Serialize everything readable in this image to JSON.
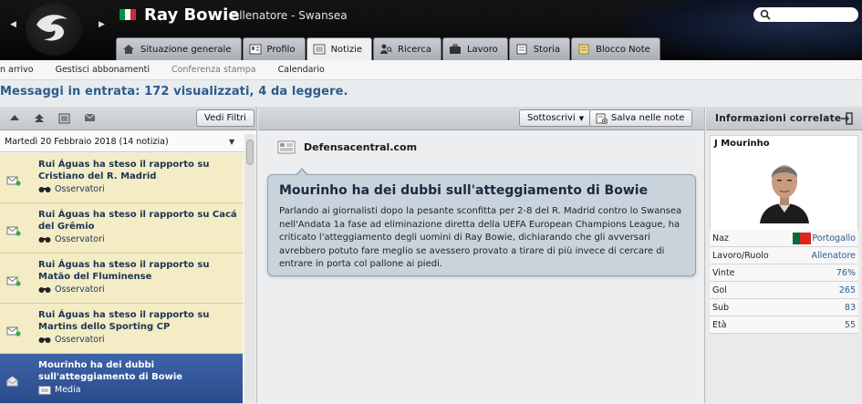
{
  "header": {
    "manager_name": "Ray Bowie",
    "manager_role": "Allenatore - Swansea",
    "flag_colors": [
      "#009246",
      "#ffffff",
      "#ce2b37"
    ]
  },
  "tabs": [
    {
      "label": "Situazione generale",
      "icon": "home-icon",
      "active": false
    },
    {
      "label": "Profilo",
      "icon": "profile-card-icon",
      "active": false
    },
    {
      "label": "Notizie",
      "icon": "news-icon",
      "active": true
    },
    {
      "label": "Ricerca",
      "icon": "scout-icon",
      "active": false
    },
    {
      "label": "Lavoro",
      "icon": "briefcase-icon",
      "active": false
    },
    {
      "label": "Storia",
      "icon": "book-icon",
      "active": false
    },
    {
      "label": "Blocco Note",
      "icon": "notepad-icon",
      "active": false
    }
  ],
  "subnav": {
    "items": [
      "n arrivo",
      "Gestisci abbonamenti",
      "Conferenza stampa",
      "Calendario"
    ]
  },
  "inbox": {
    "title": "Messaggi in entrata: 172 visualizzati, 4 da leggere."
  },
  "left_panel": {
    "filter_button": "Vedi Filtri",
    "date_header": "Martedì 20 Febbraio 2018 (14 notizia)",
    "messages": [
      {
        "title": "Rui Águas ha steso il rapporto su Cristiano del R. Madrid",
        "source": "Osservatori",
        "source_icon": "binoculars-icon"
      },
      {
        "title": "Rui Águas ha steso il rapporto su Cacá del Grêmio",
        "source": "Osservatori",
        "source_icon": "binoculars-icon"
      },
      {
        "title": "Rui Águas ha steso il rapporto su Matão del Fluminense",
        "source": "Osservatori",
        "source_icon": "binoculars-icon"
      },
      {
        "title": "Rui Águas ha steso il rapporto su Martins dello Sporting CP",
        "source": "Osservatori",
        "source_icon": "binoculars-icon"
      },
      {
        "title": "Mourinho ha dei dubbi sull'atteggiamento di Bowie",
        "source": "Media",
        "source_icon": "newspaper-icon"
      }
    ]
  },
  "mid_panel": {
    "subscribe_button": "Sottoscrivi",
    "save_button": "Salva nelle note",
    "source": "Defensacentral.com",
    "headline": "Mourinho ha dei dubbi sull'atteggiamento di Bowie",
    "body": "Parlando ai giornalisti dopo la pesante sconfitta per 2-8 del R. Madrid contro lo Swansea nell'Andata 1a fase ad eliminazione diretta della UEFA European Champions League, ha criticato l'atteggiamento degli uomini di Ray Bowie, dichiarando che gli avversari avrebbero potuto fare meglio se avessero provato a tirare di più invece di cercare di entrare in porta col pallone ai piedi."
  },
  "right_panel": {
    "title": "Informazioni correlate",
    "person_name": "J Mourinho",
    "rows": [
      {
        "key": "Naz",
        "value": "Portogallo"
      },
      {
        "key": "Lavoro/Ruolo",
        "value": "Allenatore"
      },
      {
        "key": "Vinte",
        "value": "76%"
      },
      {
        "key": "Gol",
        "value": "265"
      },
      {
        "key": "Sub",
        "value": "83"
      },
      {
        "key": "Età",
        "value": "55"
      }
    ]
  },
  "colors": {
    "accent_blue": "#2a5c8a",
    "message_unread_bg": "#f3ecc4",
    "message_selected_bg": "#2a4c8c",
    "bubble_bg": "#c9d3dc"
  }
}
